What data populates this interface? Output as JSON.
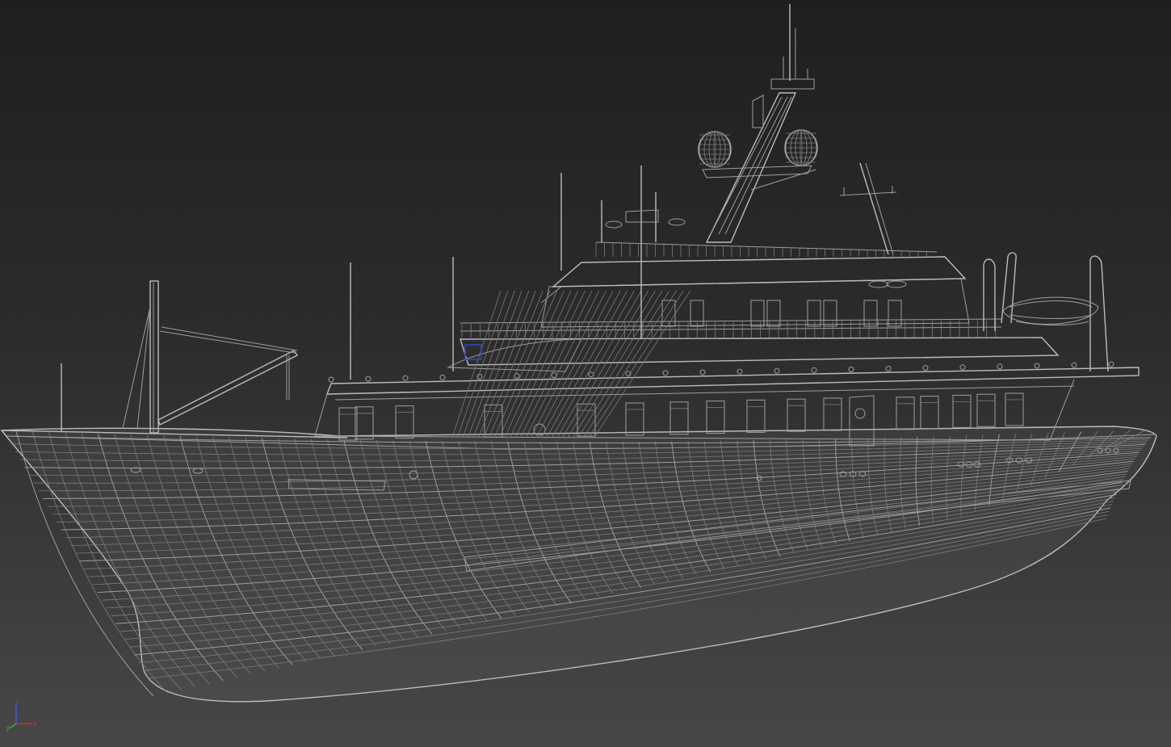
{
  "viewport": {
    "render_mode": "wireframe",
    "background_top": "#1f1f1f",
    "background_bottom": "#474747",
    "wire_color": "#9e9e9e",
    "selection_color": "#2a49c8"
  },
  "axis_gizmo": {
    "x_label": "x",
    "y_label": "y",
    "z_label": "z",
    "x_color": "#d23030",
    "y_color": "#30b040",
    "z_color": "#3a5be0"
  }
}
